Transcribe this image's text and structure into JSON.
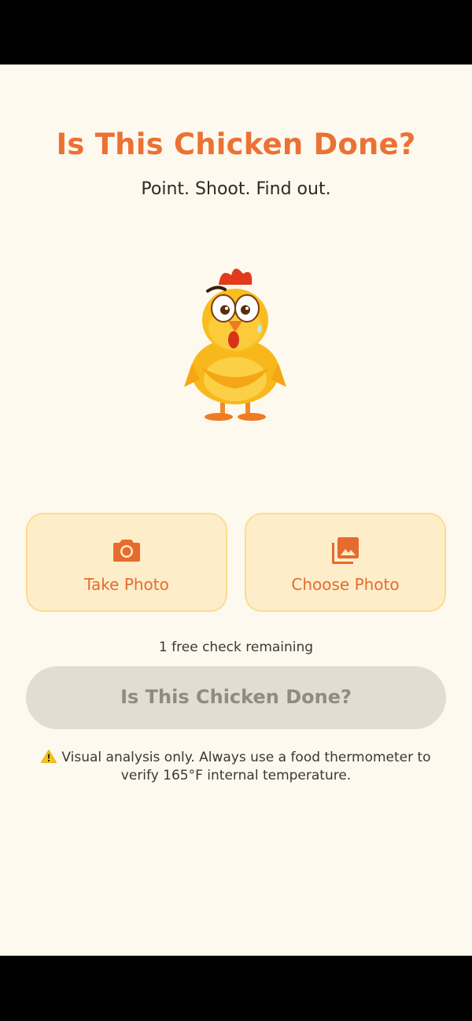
{
  "app": {
    "title": "Is This Chicken Done?",
    "subtitle": "Point. Shoot. Find out."
  },
  "mascot": {
    "icon": "chicken-mascot"
  },
  "actions": {
    "take_photo": {
      "label": "Take Photo",
      "icon": "camera-icon"
    },
    "choose_photo": {
      "label": "Choose Photo",
      "icon": "gallery-icon"
    }
  },
  "status": {
    "free_checks": "1 free check remaining"
  },
  "check_button": {
    "label": "Is This Chicken Done?",
    "enabled": false
  },
  "disclaimer": {
    "icon": "warning-icon",
    "text": "Visual analysis only. Always use a food thermometer to verify 165°F internal temperature."
  },
  "colors": {
    "accent": "#eb7134",
    "background": "#fdf9ee",
    "card": "#feedc9",
    "card_border": "#fbdc92",
    "disabled_button": "#e2dcd1",
    "disabled_text": "#8f8b83"
  }
}
